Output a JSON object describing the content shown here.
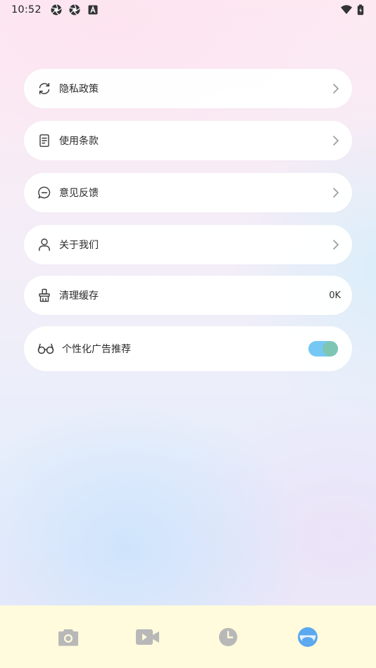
{
  "status_bar": {
    "time": "10:52",
    "left_icons": [
      "aperture-icon",
      "aperture-icon",
      "font-a-icon"
    ],
    "right_icons": [
      "wifi-icon",
      "battery-icon"
    ]
  },
  "settings": {
    "items": [
      {
        "id": "privacy",
        "label": "隐私政策",
        "icon": "refresh-icon",
        "type": "link"
      },
      {
        "id": "terms",
        "label": "使用条款",
        "icon": "document-icon",
        "type": "link"
      },
      {
        "id": "feedback",
        "label": "意见反馈",
        "icon": "chat-bubble-icon",
        "type": "link"
      },
      {
        "id": "about",
        "label": "关于我们",
        "icon": "person-icon",
        "type": "link"
      },
      {
        "id": "clear_cache",
        "label": "清理缓存",
        "icon": "broom-icon",
        "type": "value",
        "value": "0K"
      },
      {
        "id": "personalized_ads",
        "label": "个性化广告推荐",
        "icon": "glasses-icon",
        "type": "toggle",
        "on": true
      }
    ]
  },
  "bottom_nav": {
    "items": [
      "camera-icon",
      "video-icon",
      "clock-icon",
      "profile-icon"
    ],
    "active_index": 3,
    "colors": {
      "inactive": "#b8b8b8",
      "active": "#5aa8ef"
    }
  }
}
